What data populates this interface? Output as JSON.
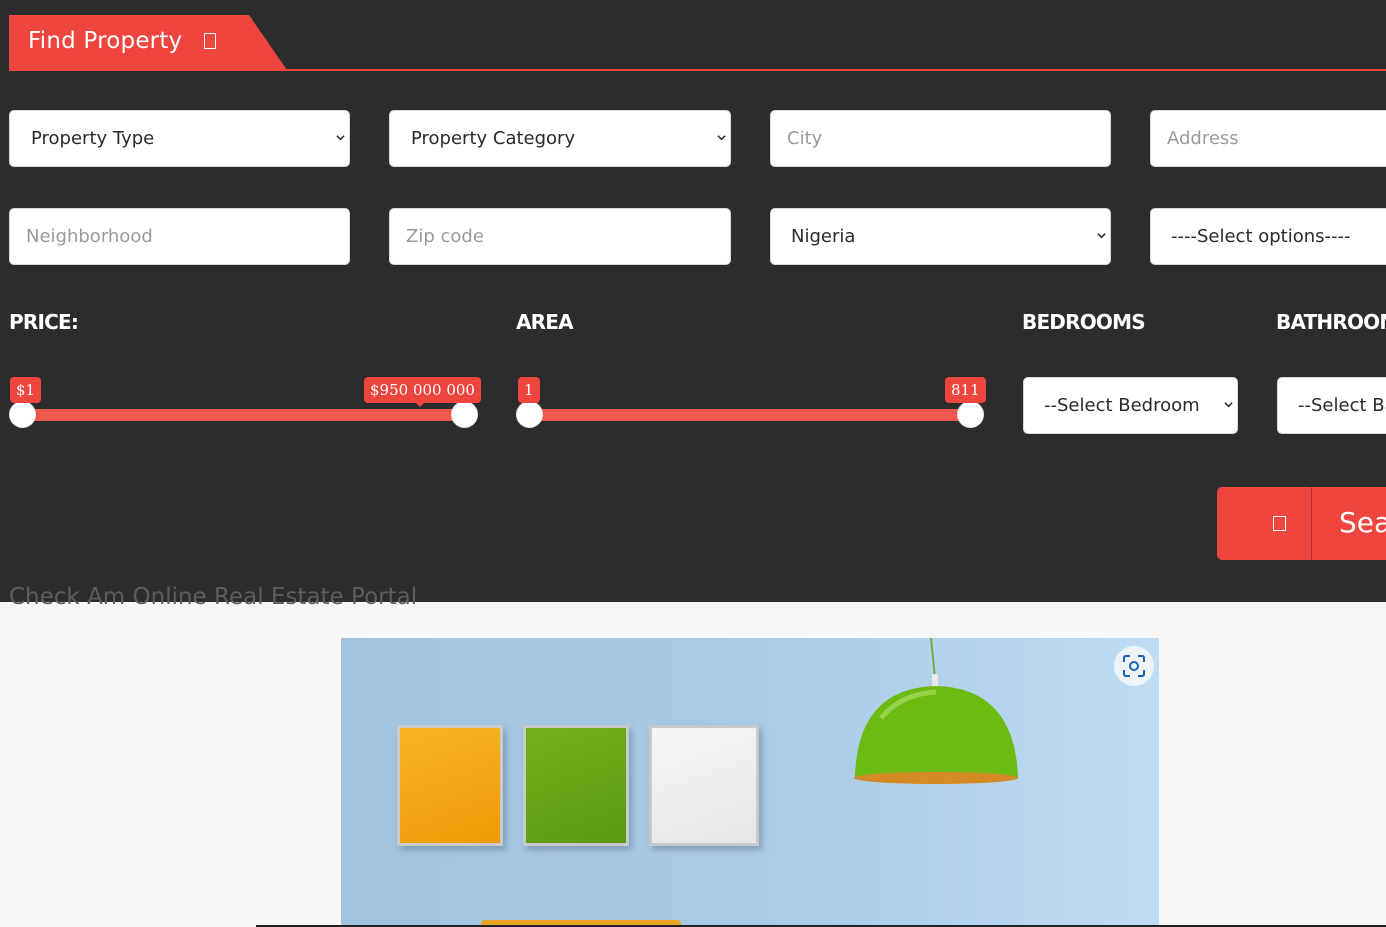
{
  "header": {
    "title": "Find Property",
    "icon": "square-icon"
  },
  "filters": {
    "property_type": "Property Type",
    "property_category": "Property Category",
    "city_placeholder": "City",
    "address_placeholder": "Address",
    "neighborhood_placeholder": "Neighborhood",
    "zip_placeholder": "Zip code",
    "country": "Nigeria",
    "options": "----Select options----"
  },
  "price": {
    "label": "PRICE:",
    "min": "$1",
    "max": "$950 000 000"
  },
  "area": {
    "label": "AREA",
    "min": "1",
    "max": "811"
  },
  "bedrooms": {
    "label": "BEDROOMS",
    "select": "--Select Bedroom"
  },
  "bathrooms": {
    "label": "BATHROOMS",
    "select": "--Select Bathroom"
  },
  "search_button": {
    "label": "Search",
    "icon": "square-icon"
  },
  "tagline": "Check Am Online Real Estate Portal",
  "colors": {
    "accent": "#ef453f",
    "panel": "#2c2c2c",
    "page": "#f7f7f7"
  },
  "photo": {
    "icon": "visual-search-icon"
  }
}
